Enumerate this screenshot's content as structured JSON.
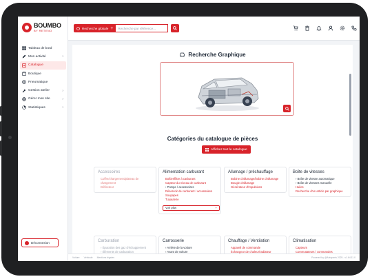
{
  "brand": {
    "name": "BOUMBO",
    "tagline": "BY RETENO"
  },
  "sidebar": {
    "items": [
      {
        "label": "Tableau de bord",
        "icon": "dashboard-icon",
        "chevron": false,
        "active": false
      },
      {
        "label": "Mon activité",
        "icon": "pencil-icon",
        "chevron": true,
        "active": false
      },
      {
        "label": "Catalogue",
        "icon": "catalog-icon",
        "chevron": false,
        "active": true
      },
      {
        "label": "Boutique",
        "icon": "shop-icon",
        "chevron": false,
        "active": false
      },
      {
        "label": "Pneumatique",
        "icon": "tire-icon",
        "chevron": false,
        "active": false
      },
      {
        "label": "Gestion atelier",
        "icon": "wrench-icon",
        "chevron": true,
        "active": false
      },
      {
        "label": "Gérer mon site",
        "icon": "globe-icon",
        "chevron": true,
        "active": false
      },
      {
        "label": "Statistiques",
        "icon": "chart-icon",
        "chevron": true,
        "active": false
      }
    ],
    "logout_label": "Déconnexion"
  },
  "topbar": {
    "scope_label": "Recherche globale",
    "search_placeholder": "Recherche par référence...",
    "icons": [
      "cart-icon",
      "trash-icon",
      "bell-icon",
      "user-icon",
      "settings-icon",
      "phone-icon"
    ]
  },
  "graphic_search": {
    "title": "Recherche Graphique"
  },
  "catalog": {
    "title": "Catégories du catalogue de pièces",
    "show_all_label": "Afficher tout le catalogue",
    "more_label": "Voir plus",
    "cards": [
      {
        "title": "Accessoires",
        "faded": true,
        "links": [
          {
            "text": "Coffre/chargement/plateau de chargement",
            "sub": false
          },
          {
            "text": "Déflecteur",
            "sub": false
          }
        ]
      },
      {
        "title": "Alimentation carburant",
        "faded": false,
        "more": true,
        "links": [
          {
            "text": "Boîtier/filtre à carburant",
            "sub": false
          },
          {
            "text": "Capteur du niveau de carburant",
            "sub": false
          },
          {
            "text": "Pompe / accessoires",
            "sub": true
          },
          {
            "text": "Réservoir de carburant / accessoires",
            "sub": false
          },
          {
            "text": "Soupapes",
            "sub": false
          },
          {
            "text": "Tuyauterie",
            "sub": false
          }
        ]
      },
      {
        "title": "Allumage / préchauffage",
        "faded": false,
        "links": [
          {
            "text": "Bobine d'allumage/bobine d'allumage",
            "sub": false
          },
          {
            "text": "Bougie d'allumage",
            "sub": false
          },
          {
            "text": "Générateur d'impulsions",
            "sub": false
          }
        ]
      },
      {
        "title": "Boîte de vitesses",
        "faded": false,
        "links": [
          {
            "text": "Boîte de vitesse automatique",
            "sub": true
          },
          {
            "text": "Boîte de vitesses manuelle",
            "sub": true
          },
          {
            "text": "Huiles",
            "sub": false
          },
          {
            "text": "Recherche d'un article par graphique",
            "sub": false
          }
        ]
      },
      {
        "title": "Carburation",
        "faded": true,
        "links": [
          {
            "text": "Épuration des gaz d'échappement",
            "sub": true
          },
          {
            "text": "Éléments de carburation",
            "sub": true
          }
        ]
      },
      {
        "title": "Carrosserie",
        "faded": false,
        "links": [
          {
            "text": "Arrière de la voiture",
            "sub": true
          },
          {
            "text": "Avant de voiture",
            "sub": true
          }
        ]
      },
      {
        "title": "Chauffage / Ventilation",
        "faded": false,
        "links": [
          {
            "text": "Appareil de commande",
            "sub": false
          },
          {
            "text": "Échangeur de chaleur/radiateur",
            "sub": false
          }
        ]
      },
      {
        "title": "Climatisation",
        "faded": false,
        "links": [
          {
            "text": "Capteurs",
            "sub": false
          },
          {
            "text": "Commutateurs / commandes",
            "sub": false
          }
        ]
      }
    ]
  },
  "footer": {
    "left": [
      "Voiture",
      "Véhicule",
      "Mentions légales"
    ],
    "right": "Powered by @Autoparts 2025 - v1.64.11.0"
  },
  "colors": {
    "accent": "#d8232a",
    "device": "#1f2022",
    "background": "#f2f4f7"
  }
}
